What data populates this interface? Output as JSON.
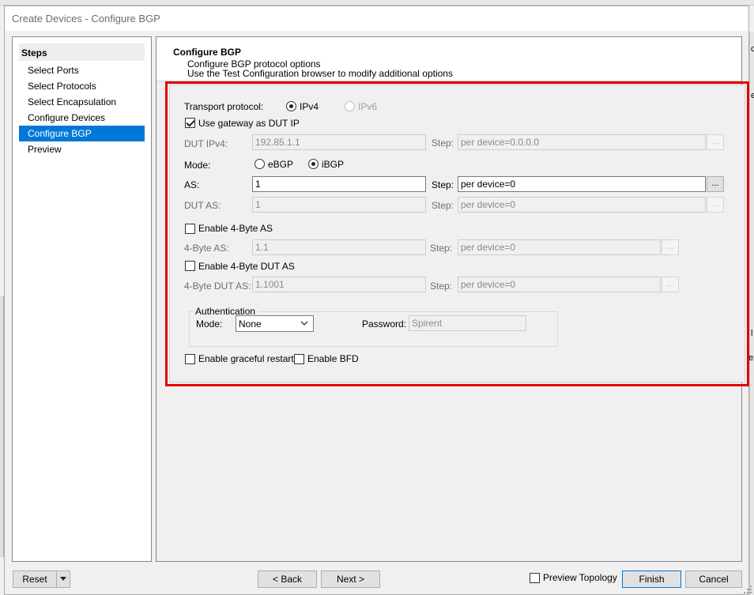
{
  "background": {
    "right_fragments": [
      "c",
      "e",
      "l",
      "ex"
    ]
  },
  "dialog": {
    "title": "Create Devices - Configure BGP"
  },
  "steps": {
    "header": "Steps",
    "items": [
      {
        "label": "Select Ports",
        "selected": false
      },
      {
        "label": "Select Protocols",
        "selected": false
      },
      {
        "label": "Select Encapsulation",
        "selected": false
      },
      {
        "label": "Configure Devices",
        "selected": false
      },
      {
        "label": "Configure BGP",
        "selected": true
      },
      {
        "label": "Preview",
        "selected": false
      }
    ]
  },
  "header": {
    "title": "Configure BGP",
    "subtitle1": "Configure BGP protocol options",
    "subtitle2": "Use the Test Configuration browser to modify additional options"
  },
  "form": {
    "transport_label": "Transport protocol:",
    "ipv4_label": "IPv4",
    "ipv6_label": "IPv6",
    "use_gateway_label": "Use gateway as DUT IP",
    "dut_ipv4_label": "DUT IPv4:",
    "dut_ipv4_value": "192.85.1.1",
    "step_label": "Step:",
    "dut_ipv4_step": "per device=0.0.0.0",
    "mode_label": "Mode:",
    "ebgp_label": "eBGP",
    "ibgp_label": "iBGP",
    "as_label": "AS:",
    "as_value": "1",
    "as_step": "per device=0",
    "dut_as_label": "DUT AS:",
    "dut_as_value": "1",
    "dut_as_step": "per device=0",
    "enable_4byte_as_label": "Enable 4-Byte AS",
    "four_byte_as_label": "4-Byte AS:",
    "four_byte_as_value": "1.1",
    "four_byte_as_step": "per device=0",
    "enable_4byte_dut_as_label": "Enable 4-Byte DUT AS",
    "four_byte_dut_as_label": "4-Byte DUT AS:",
    "four_byte_dut_as_value": "1.1001",
    "four_byte_dut_as_step": "per device=0",
    "ellipsis": "...",
    "auth_group_label": "Authentication",
    "auth_mode_label": "Mode:",
    "auth_mode_value": "None",
    "password_label": "Password:",
    "password_value": "Spirent",
    "graceful_restart_label": "Enable graceful restart",
    "bfd_label": "Enable BFD"
  },
  "footer": {
    "reset_label": "Reset",
    "back_label": "< Back",
    "next_label": "Next >",
    "preview_topology_label": "Preview Topology",
    "finish_label": "Finish",
    "cancel_label": "Cancel"
  },
  "colors": {
    "selection": "#0078d7",
    "highlight_border": "#e00000"
  }
}
